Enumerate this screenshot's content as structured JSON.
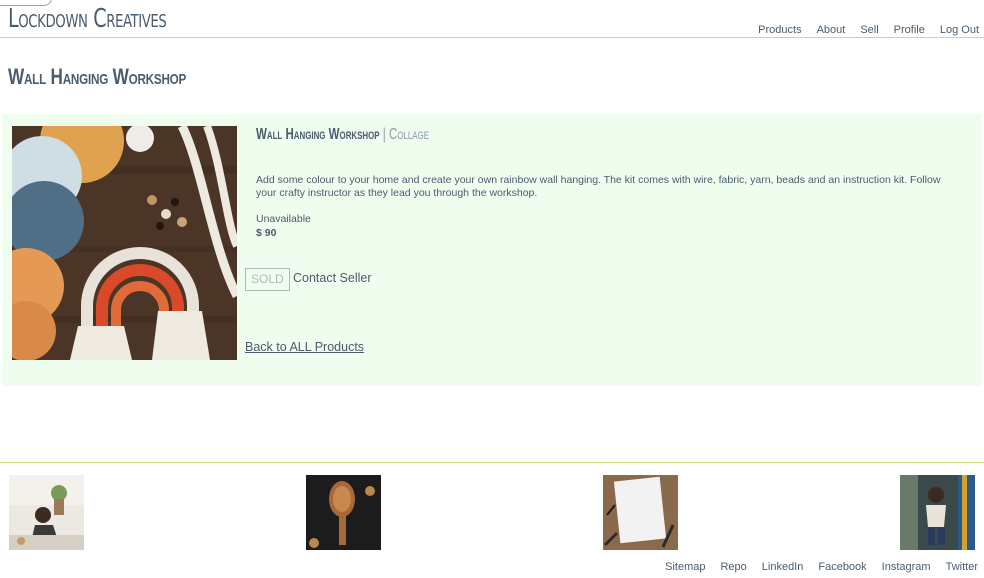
{
  "header": {
    "brand": "Lockdown Creatives",
    "nav": [
      "Products",
      "About",
      "Sell",
      "Profile",
      "Log Out"
    ]
  },
  "page": {
    "title": "Wall Hanging Workshop"
  },
  "product": {
    "name": "Wall Hanging Workshop",
    "separator": "|",
    "category": "Collage",
    "description": "Add some colour to your home and create your own rainbow wall hanging. The kit comes with wire, fabric, yarn, beads and an instruction kit. Follow your crafty instructor as they lead you through the workshop.",
    "availability": "Unavailable",
    "price": "$ 90",
    "sold_label": "SOLD",
    "contact_label": "Contact Seller",
    "back_link": "Back to ALL Products"
  },
  "footer": {
    "links": [
      "Sitemap",
      "Repo",
      "LinkedIn",
      "Facebook",
      "Instagram",
      "Twitter"
    ]
  },
  "colors": {
    "accent_line": "#c8e07a",
    "panel_bg": "#effdef",
    "text": "#4a5c6e"
  }
}
